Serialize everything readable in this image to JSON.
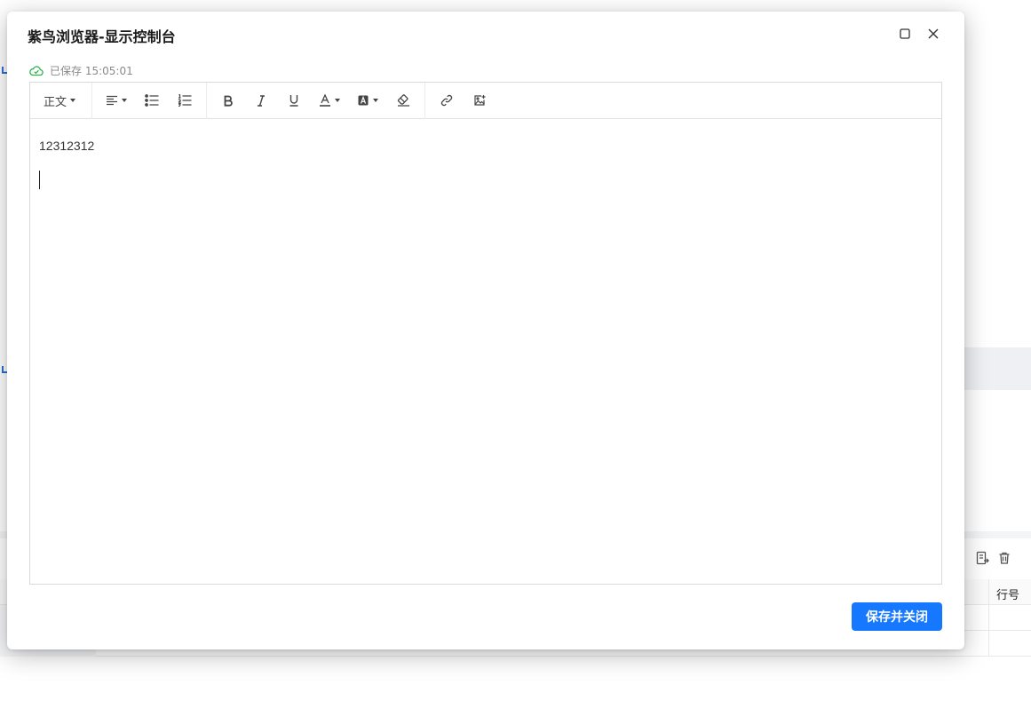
{
  "dialog": {
    "title": "紫鸟浏览器-显示控制台",
    "save_status": "已保存 15:05:01",
    "primary_button": "保存并关闭"
  },
  "toolbar": {
    "paragraph_style": "正文"
  },
  "editor": {
    "paragraphs": [
      "12312312",
      ""
    ]
  },
  "background": {
    "table_header_col": "行号"
  },
  "colors": {
    "primary": "#1677ff",
    "saved_green": "#2bb24c"
  }
}
